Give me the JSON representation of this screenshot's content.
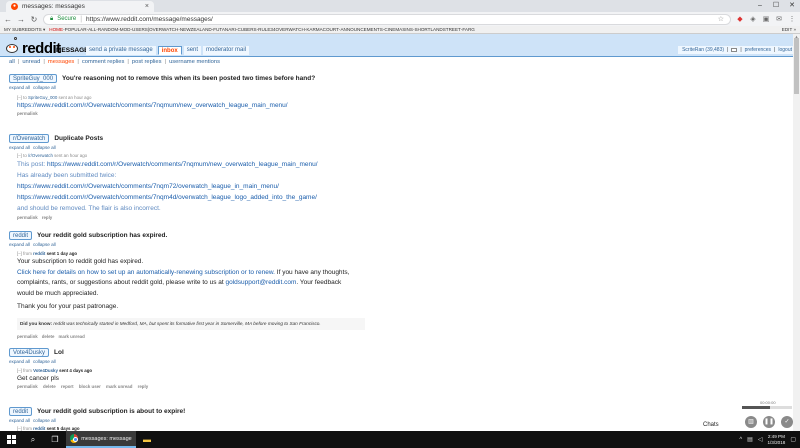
{
  "browser": {
    "tab_title": "messages: messages",
    "tab_close": "×",
    "win_min": "–",
    "win_max": "☐",
    "win_close": "✕",
    "secure_label": "Secure",
    "url": "https://www.reddit.com/message/messages/"
  },
  "srbar": {
    "my_subreddits": "MY SUBREDDITS ▾",
    "items": [
      "HOME",
      "POPULAR",
      "ALL",
      "RANDOM",
      "MOD",
      "USERS",
      "OVERWATCH",
      "NEWZEALAND",
      "FUTANARI",
      "CUBERS",
      "RULE34OVERWATCH",
      "KARMACOURT",
      "ANNOUNCEMENTS",
      "CINEMASINS",
      "SHORTLANDSTREET",
      "FARG"
    ],
    "edit": "EDIT »"
  },
  "header": {
    "wordmark": "reddit",
    "page_name": "MESSAGE",
    "tabs": [
      {
        "label": "send a private message",
        "selected": false
      },
      {
        "label": "inbox",
        "selected": true
      },
      {
        "label": "sent",
        "selected": false
      },
      {
        "label": "moderator mail",
        "selected": false
      }
    ],
    "user": "ScriteRan (39,483)",
    "preferences": "preferences",
    "logout": "logout"
  },
  "filters": [
    {
      "label": "all",
      "selected": false
    },
    {
      "label": "unread",
      "selected": false
    },
    {
      "label": "messages",
      "selected": true
    },
    {
      "label": "comment replies",
      "selected": false
    },
    {
      "label": "post replies",
      "selected": false
    },
    {
      "label": "username mentions",
      "selected": false
    }
  ],
  "thread_controls": {
    "expand": "expand all",
    "collapse": "collapse all"
  },
  "messages": [
    {
      "author": "SpriteGuy_000",
      "subject": "You're reasoning not to remove this when its been posted two times before hand?",
      "meta_prefix": "[–] to",
      "meta_user": "SpriteGuy_000",
      "meta_time": "sent an hour ago",
      "body": "https://www.reddit.com/r/Overwatch/comments/7nqmum/new_overwatch_league_main_menu/",
      "actions": [
        "permalink"
      ]
    },
    {
      "author": "r/Overwatch",
      "subject": "Duplicate Posts",
      "meta_prefix": "[–] to",
      "meta_user": "/r/Overwatch",
      "meta_time": "sent an hour ago",
      "body_lines": [
        {
          "text": "This post: ",
          "link": "https://www.reddit.com/r/Overwatch/comments/7nqmum/new_overwatch_league_main_menu/"
        },
        {
          "text": "Has already been submitted twice:",
          "link": ""
        },
        {
          "text": "",
          "link": "https://www.reddit.com/r/Overwatch/comments/7nqm72/overwatch_league_in_main_menu/"
        },
        {
          "text": "",
          "link": "https://www.reddit.com/r/Overwatch/comments/7nqm4d/overwatch_league_logo_added_into_the_game/"
        },
        {
          "text": "and should be removed. The flair is also incorrect.",
          "link": ""
        }
      ],
      "actions": [
        "permalink",
        "reply"
      ]
    },
    {
      "author": "reddit",
      "subject": "Your reddit gold subscription has expired.",
      "meta_prefix": "[–] from",
      "meta_user": "reddit",
      "meta_time": "sent 1 day ago",
      "line1": "Your subscription to reddit gold has expired.",
      "line2_link": "Click here for details on how to set up an automatically-renewing subscription or to renew.",
      "line2_text": " If you have any thoughts,",
      "line3": "complaints, rants, or suggestions about reddit gold, please write to us at ",
      "line3_link": "goldsupport@reddit.com",
      "line3_end": ". Your feedback",
      "line4": "would be much appreciated.",
      "line5": "Thank you for your past patronage.",
      "dyk_label": "Did you know:",
      "dyk_text": " reddit was technically started in Medford, MA, but spent its formative first year in Somerville, MA before moving to San Francisco.",
      "actions": [
        "permalink",
        "delete",
        "mark unread"
      ]
    },
    {
      "author": "Vote4Dusky",
      "subject": "Lol",
      "meta_prefix": "[–] from",
      "meta_user": "Vote4Dusky",
      "meta_time": "sent 4 days ago",
      "body": "Get cancer pls",
      "actions": [
        "permalink",
        "delete",
        "report",
        "block user",
        "mark unread",
        "reply"
      ]
    },
    {
      "author": "reddit",
      "subject": "Your reddit gold subscription is about to expire!",
      "meta_prefix": "[–] from",
      "meta_user": "reddit",
      "meta_time": "sent 5 days ago"
    }
  ],
  "chat": {
    "label": "Chats",
    "timer": "00:00:00"
  },
  "taskbar": {
    "app_title": "messages: message...",
    "time": "2:49 PM",
    "date": "1/3/2018"
  }
}
